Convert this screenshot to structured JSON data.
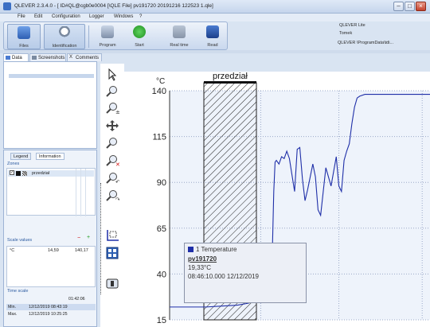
{
  "window": {
    "title": "QLEVER 2.3.4.0 - [ ID#QL@cgb0e0004 [\\QLE File]  pv191720 20191216 122523 1.qle]"
  },
  "menu": [
    "File",
    "Edit",
    "Configuration",
    "Logger",
    "Windows",
    "?"
  ],
  "toolbar": {
    "files": "Files",
    "identification": "Identification",
    "program": "Program",
    "start": "Start",
    "realtime": "Real time",
    "read": "Read"
  },
  "info_right": {
    "app": "QLEVER Lite",
    "user": "Tomek",
    "path": "QLEVER \\ProgramData\\tdi..."
  },
  "tabs": [
    "Data",
    "Screenshots",
    "Comments"
  ],
  "left": {
    "subtabs": [
      "Legend",
      "Information"
    ],
    "zones_label": "Zones",
    "zone_name": "przedział",
    "scale_label": "Scale values",
    "scale_row": {
      "unit": "°C",
      "min": "14,59",
      "max": "140,17"
    },
    "time_scale_label": "Time scale",
    "time_span": "01:42:06",
    "min_label": "Min.",
    "min_time": "12/12/2019   08:43:19",
    "max_label": "Max.",
    "max_time": "12/12/2019   10:25:25"
  },
  "tools": [
    "pointer-icon",
    "zoom-box-icon",
    "zoom-icon",
    "pan-icon",
    "zoom-x-icon",
    "zoom-reset-icon",
    "undo-zoom-icon",
    "redo-zoom-icon",
    "zone-icon",
    "grid-icon",
    "screenshot-icon"
  ],
  "chart_data": {
    "type": "line",
    "ylabel": "°C",
    "ylim": [
      15,
      140
    ],
    "yticks": [
      140,
      115,
      90,
      65,
      40,
      15
    ],
    "zone_label": "przedział",
    "series": [
      {
        "name": "Temperature",
        "color": "#1f2fa8",
        "x": [
          0,
          0.04,
          0.08,
          0.14,
          0.2,
          0.26,
          0.3,
          0.34,
          0.36,
          0.375,
          0.385,
          0.395,
          0.4,
          0.405,
          0.41,
          0.42,
          0.43,
          0.44,
          0.45,
          0.46,
          0.47,
          0.48,
          0.49,
          0.5,
          0.51,
          0.52,
          0.53,
          0.54,
          0.55,
          0.56,
          0.57,
          0.58,
          0.59,
          0.6,
          0.61,
          0.62,
          0.63,
          0.64,
          0.65,
          0.66,
          0.67,
          0.68,
          0.69,
          0.7,
          0.71,
          0.72,
          0.73,
          0.75,
          0.78,
          0.82,
          0.86,
          0.9,
          0.95,
          1.0
        ],
        "values": [
          22,
          22,
          22,
          22,
          22.5,
          23,
          24,
          25.5,
          27,
          28.5,
          35,
          55,
          85,
          101,
          102,
          100,
          104,
          103,
          107,
          103,
          94,
          85,
          108,
          109,
          92,
          80,
          86,
          93,
          100,
          93,
          75,
          72,
          85,
          98,
          93,
          88,
          96,
          104,
          88,
          85,
          102,
          107,
          111,
          122,
          131,
          136,
          137,
          138,
          138,
          138,
          138,
          138,
          138,
          138
        ]
      }
    ],
    "tooltip": {
      "series": "1  Temperature",
      "name": "pv191720",
      "value": "19,33°C",
      "time": "08:46:10.000 12/12/2019"
    }
  }
}
